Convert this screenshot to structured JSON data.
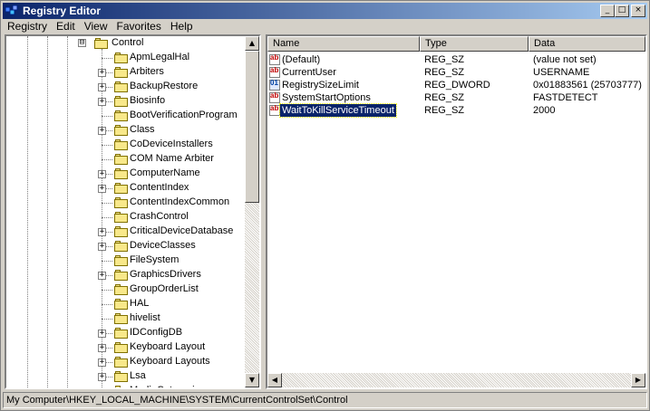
{
  "window": {
    "title": "Registry Editor"
  },
  "title_controls": {
    "minimize": "_",
    "maximize": "□",
    "close": "×"
  },
  "menu": [
    {
      "label": "Registry"
    },
    {
      "label": "Edit"
    },
    {
      "label": "View"
    },
    {
      "label": "Favorites"
    },
    {
      "label": "Help"
    }
  ],
  "tree": {
    "parent": {
      "label": "Control",
      "expander": "⊟"
    },
    "items": [
      {
        "label": "ApmLegalHal",
        "expandable": false
      },
      {
        "label": "Arbiters",
        "expandable": true
      },
      {
        "label": "BackupRestore",
        "expandable": true
      },
      {
        "label": "Biosinfo",
        "expandable": true
      },
      {
        "label": "BootVerificationProgram",
        "expandable": false
      },
      {
        "label": "Class",
        "expandable": true
      },
      {
        "label": "CoDeviceInstallers",
        "expandable": false
      },
      {
        "label": "COM Name Arbiter",
        "expandable": false
      },
      {
        "label": "ComputerName",
        "expandable": true
      },
      {
        "label": "ContentIndex",
        "expandable": true
      },
      {
        "label": "ContentIndexCommon",
        "expandable": false
      },
      {
        "label": "CrashControl",
        "expandable": false
      },
      {
        "label": "CriticalDeviceDatabase",
        "expandable": true
      },
      {
        "label": "DeviceClasses",
        "expandable": true
      },
      {
        "label": "FileSystem",
        "expandable": false
      },
      {
        "label": "GraphicsDrivers",
        "expandable": true
      },
      {
        "label": "GroupOrderList",
        "expandable": false
      },
      {
        "label": "HAL",
        "expandable": false
      },
      {
        "label": "hivelist",
        "expandable": false
      },
      {
        "label": "IDConfigDB",
        "expandable": true
      },
      {
        "label": "Keyboard Layout",
        "expandable": true
      },
      {
        "label": "Keyboard Layouts",
        "expandable": true
      },
      {
        "label": "Lsa",
        "expandable": true
      },
      {
        "label": "MediaCategories",
        "expandable": true
      }
    ]
  },
  "list": {
    "columns": [
      {
        "label": "Name"
      },
      {
        "label": "Type"
      },
      {
        "label": "Data"
      }
    ],
    "rows": [
      {
        "name": "(Default)",
        "type": "REG_SZ",
        "data": "(value not set)",
        "icon": "string-value-icon",
        "selected": false
      },
      {
        "name": "CurrentUser",
        "type": "REG_SZ",
        "data": "USERNAME",
        "icon": "string-value-icon",
        "selected": false
      },
      {
        "name": "RegistrySizeLimit",
        "type": "REG_DWORD",
        "data": "0x01883561 (25703777)",
        "icon": "binary-value-icon",
        "selected": false
      },
      {
        "name": "SystemStartOptions",
        "type": "REG_SZ",
        "data": "FASTDETECT",
        "icon": "string-value-icon",
        "selected": false
      },
      {
        "name": "WaitToKillServiceTimeout",
        "type": "REG_SZ",
        "data": "2000",
        "icon": "string-value-icon",
        "selected": true
      }
    ]
  },
  "statusbar": {
    "path": "My Computer\\HKEY_LOCAL_MACHINE\\SYSTEM\\CurrentControlSet\\Control"
  },
  "colors": {
    "title_active": "#0a246a",
    "selection": "#0a246a",
    "face": "#d4d0c8"
  }
}
